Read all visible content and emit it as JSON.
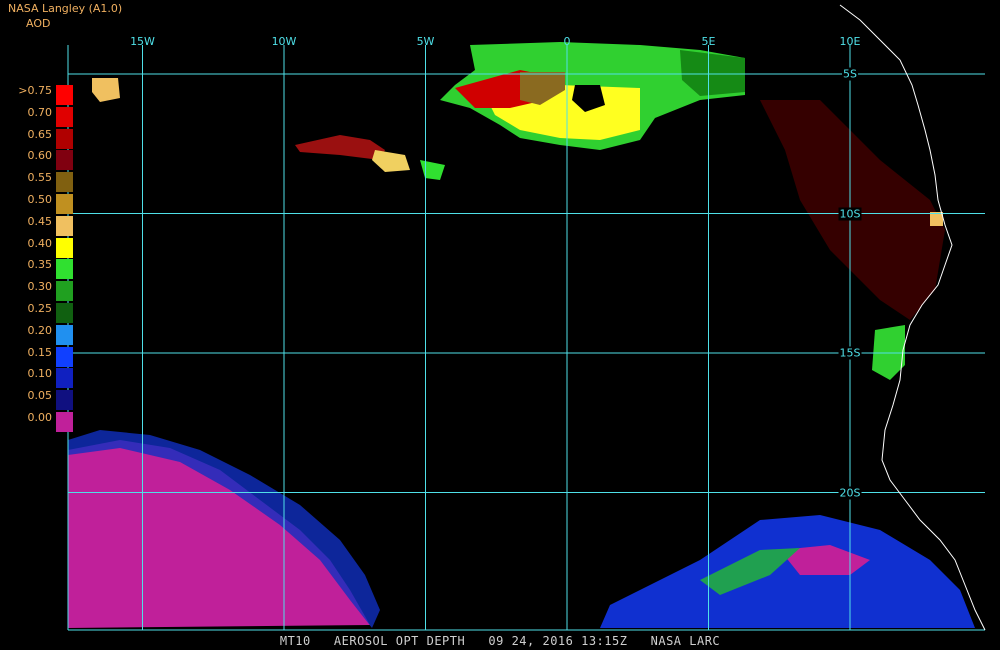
{
  "header": {
    "product": "NASA Langley (A1.0)",
    "parameter": "AOD"
  },
  "footer": {
    "caption": "MT10   AEROSOL OPT DEPTH   09 24, 2016 13:15Z   NASA LARC"
  },
  "legend": {
    "entries": [
      {
        "label": ">0.75",
        "color": "#ff0000"
      },
      {
        "label": "0.70",
        "color": "#e00000"
      },
      {
        "label": "0.65",
        "color": "#b00000"
      },
      {
        "label": "0.60",
        "color": "#800010"
      },
      {
        "label": "0.55",
        "color": "#806010"
      },
      {
        "label": "0.50",
        "color": "#c09020"
      },
      {
        "label": "0.45",
        "color": "#f0c060"
      },
      {
        "label": "0.40",
        "color": "#ffff00"
      },
      {
        "label": "0.35",
        "color": "#30e030"
      },
      {
        "label": "0.30",
        "color": "#20a020"
      },
      {
        "label": "0.25",
        "color": "#106010"
      },
      {
        "label": "0.20",
        "color": "#2090f0"
      },
      {
        "label": "0.15",
        "color": "#1040ff"
      },
      {
        "label": "0.10",
        "color": "#1020c0"
      },
      {
        "label": "0.05",
        "color": "#101080"
      },
      {
        "label": "0.00",
        "color": "#c0209a"
      }
    ]
  },
  "grid": {
    "color": "#4fe0e8",
    "longitudes": [
      {
        "label": "15W",
        "value": -15
      },
      {
        "label": "10W",
        "value": -10
      },
      {
        "label": "5W",
        "value": -5
      },
      {
        "label": "0",
        "value": 0
      },
      {
        "label": "5E",
        "value": 5
      },
      {
        "label": "10E",
        "value": 10
      }
    ],
    "latitudes": [
      {
        "label": "5S",
        "value": -5
      },
      {
        "label": "10S",
        "value": -10
      },
      {
        "label": "15S",
        "value": -15
      },
      {
        "label": "20S",
        "value": -20
      }
    ]
  },
  "colors": {
    "coastline": "#ffffff",
    "background": "#000000"
  }
}
